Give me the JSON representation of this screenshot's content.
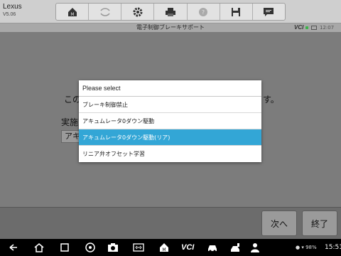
{
  "header": {
    "app_name": "Lexus",
    "version": "V5.06"
  },
  "toolbar": {
    "items": [
      {
        "icon": "home-icon"
      },
      {
        "icon": "vehicle-swap-icon"
      },
      {
        "icon": "gear-icon"
      },
      {
        "icon": "printer-icon"
      },
      {
        "icon": "help-icon"
      },
      {
        "icon": "save-icon"
      },
      {
        "icon": "chat-icon"
      }
    ]
  },
  "subheader": {
    "title": "電子制御ブレーキサポート",
    "vci_label": "VCI",
    "time": "12:07"
  },
  "background": {
    "line1_start": "この",
    "line1_end": "す。",
    "label_start": "実施",
    "field_start": "アキ"
  },
  "dialog": {
    "title": "Please select",
    "options": [
      "ブレーキ制御禁止",
      "アキュムレータ0ダウン駆動",
      "アキュムレータ0ダウン駆動(リア)",
      "リニア弁オフセット学習"
    ],
    "selected_index": 2
  },
  "buttons": {
    "next": "次へ",
    "end": "終了"
  },
  "navbar": {
    "vci_label": "VCI",
    "status": "● ▾ 98%",
    "clock": "15:51"
  },
  "colors": {
    "selected": "#33a6d6",
    "toolbar": "#cfcfcf"
  }
}
